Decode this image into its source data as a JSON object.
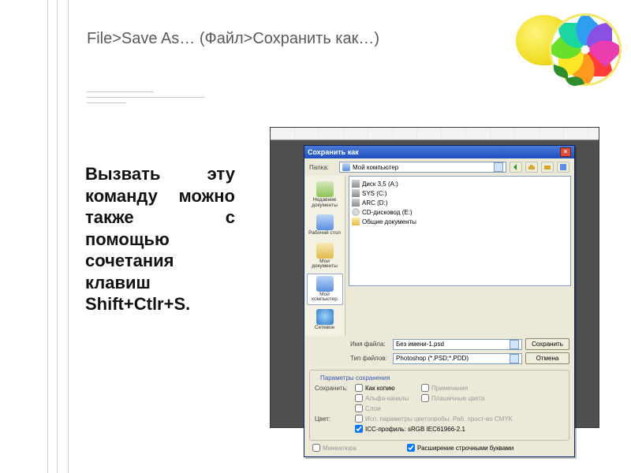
{
  "title": "File>Save As… (Файл>Сохранить как…)",
  "body": "Вызвать эту команду можно также с помощью сочетания клавиш Shift+Ctlr+S.",
  "dialog": {
    "title": "Сохранить как",
    "folder_label": "Папка:",
    "folder_value": "Мой компьютер",
    "places": {
      "recent": "Недавние документы",
      "desktop": "Рабочий стол",
      "docs": "Мои документы",
      "computer": "Мой компьютер",
      "network": "Сетевое"
    },
    "items": {
      "floppy": "Диск 3,5 (A:)",
      "sys": "SYS (C:)",
      "arc": "ARC (D:)",
      "cd": "CD-дисковод (E:)",
      "shared": "Общие документы"
    },
    "filename_label": "Имя файла:",
    "filename_value": "Без имени-1.psd",
    "filetype_label": "Тип файлов:",
    "filetype_value": "Photoshop (*.PSD;*.PDD)",
    "save_btn": "Сохранить",
    "cancel_btn": "Отмена",
    "save_group": "Параметры сохранения",
    "save_row_label": "Сохранить:",
    "cb_copy": "Как копию",
    "cb_notes": "Примечания",
    "cb_alpha": "Альфа-каналы",
    "cb_spot": "Плашечные цвета",
    "cb_layers": "Слои",
    "color_label": "Цвет:",
    "cmyk": "Исп. параметры цветопробы: Раб. прост-во CMYK",
    "icc": "ICC-профиль: sRGB IEC61966-2.1",
    "thumb": "Миниатюра",
    "lcext": "Расширение строчными буквами"
  }
}
